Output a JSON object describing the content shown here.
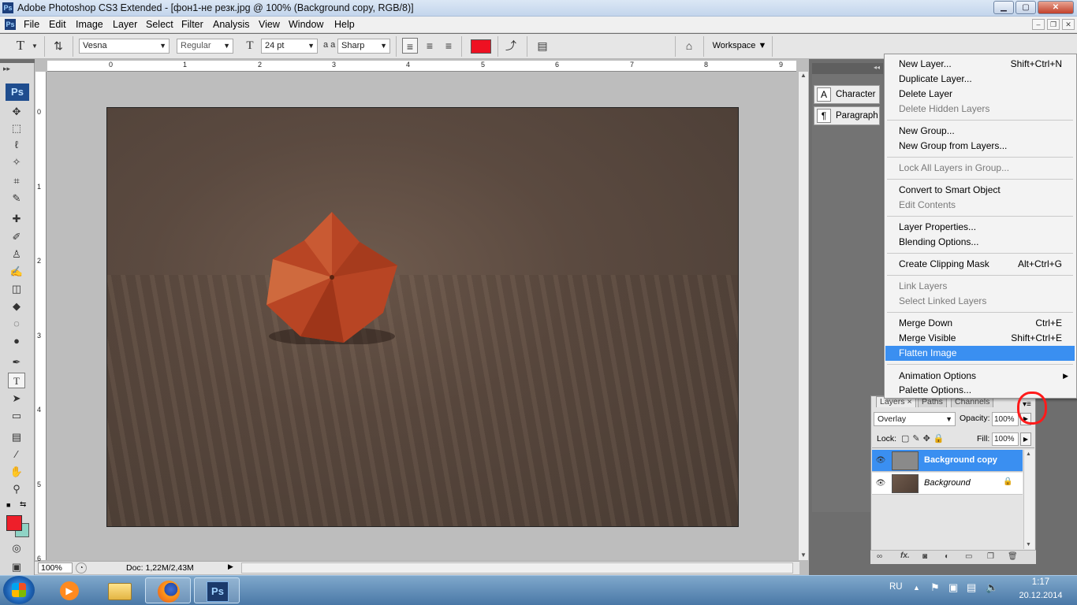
{
  "window": {
    "app_badge": "Ps",
    "title": "Adobe Photoshop CS3 Extended - [фон1-не резк.jpg @ 100% (Background copy, RGB/8)]",
    "btn_min": "▁",
    "btn_max": "▢",
    "btn_close": "✕"
  },
  "menubar": {
    "items": [
      "File",
      "Edit",
      "Image",
      "Layer",
      "Select",
      "Filter",
      "Analysis",
      "View",
      "Window",
      "Help"
    ],
    "doc_min": "–",
    "doc_restore": "❐",
    "doc_close": "✕"
  },
  "options": {
    "tool_glyph": "T",
    "font_family": "Vesna",
    "font_style": "Regular",
    "font_size": "24 pt",
    "aa_label": "a a",
    "antialias": "Sharp",
    "text_color": "#ee1122",
    "workspace": "Workspace"
  },
  "rulers": {
    "h_ticks": [
      "0",
      "1",
      "2",
      "3",
      "4",
      "5",
      "6",
      "7",
      "8",
      "9"
    ],
    "v_ticks": [
      "0",
      "1",
      "2",
      "3",
      "4",
      "5",
      "6"
    ]
  },
  "status": {
    "zoom": "100%",
    "doc_info": "Doc: 1,22M/2,43M"
  },
  "toolbox": {
    "logo": "Ps",
    "fg_color": "#ee1f2a",
    "bg_color": "#8fd3c5"
  },
  "dock": {
    "character": "Character",
    "paragraph": "Paragraph"
  },
  "context_menu": {
    "items": [
      {
        "label": "New Layer...",
        "shortcut": "Shift+Ctrl+N",
        "enabled": true
      },
      {
        "label": "Duplicate Layer...",
        "shortcut": "",
        "enabled": true
      },
      {
        "label": "Delete Layer",
        "shortcut": "",
        "enabled": true
      },
      {
        "label": "Delete Hidden Layers",
        "shortcut": "",
        "enabled": false
      },
      {
        "label": "New Group...",
        "shortcut": "",
        "enabled": true
      },
      {
        "label": "New Group from Layers...",
        "shortcut": "",
        "enabled": true
      },
      {
        "label": "Lock All Layers in Group...",
        "shortcut": "",
        "enabled": false
      },
      {
        "label": "Convert to Smart Object",
        "shortcut": "",
        "enabled": true
      },
      {
        "label": "Edit Contents",
        "shortcut": "",
        "enabled": false
      },
      {
        "label": "Layer Properties...",
        "shortcut": "",
        "enabled": true
      },
      {
        "label": "Blending Options...",
        "shortcut": "",
        "enabled": true
      },
      {
        "label": "Create Clipping Mask",
        "shortcut": "Alt+Ctrl+G",
        "enabled": true
      },
      {
        "label": "Link Layers",
        "shortcut": "",
        "enabled": false
      },
      {
        "label": "Select Linked Layers",
        "shortcut": "",
        "enabled": false
      },
      {
        "label": "Merge Down",
        "shortcut": "Ctrl+E",
        "enabled": true
      },
      {
        "label": "Merge Visible",
        "shortcut": "Shift+Ctrl+E",
        "enabled": true
      },
      {
        "label": "Flatten Image",
        "shortcut": "",
        "enabled": true,
        "highlighted": true
      },
      {
        "label": "Animation Options",
        "shortcut": "",
        "enabled": true,
        "submenu": "▶"
      },
      {
        "label": "Palette Options...",
        "shortcut": "",
        "enabled": true
      }
    ]
  },
  "layers_panel": {
    "tabs": [
      "Layers",
      "Paths",
      "Channels"
    ],
    "tab_close": "×",
    "blend_mode": "Overlay",
    "opacity_label": "Opacity:",
    "opacity": "100%",
    "lock_label": "Lock:",
    "fill_label": "Fill:",
    "fill": "100%",
    "layers": [
      {
        "name": "Background copy",
        "selected": true,
        "locked": false
      },
      {
        "name": "Background",
        "selected": false,
        "locked": true
      }
    ]
  },
  "taskbar": {
    "lang": "RU",
    "time": "1:17",
    "date": "20.12.2014",
    "ps_label": "Ps"
  }
}
